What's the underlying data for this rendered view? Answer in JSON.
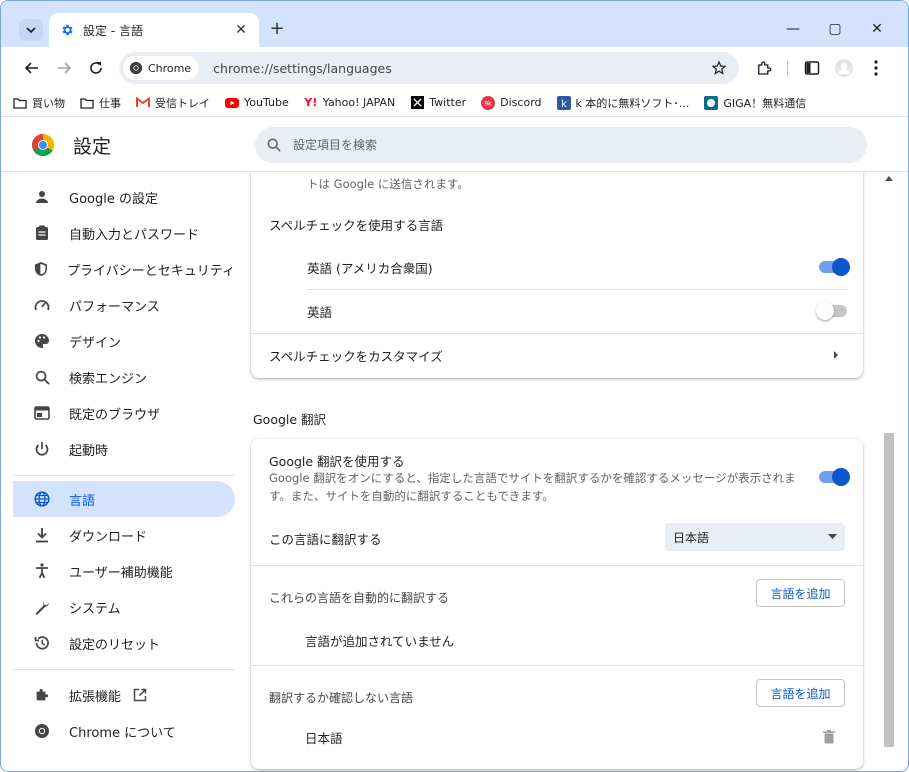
{
  "tab": {
    "title": "設定 - 言語",
    "close": "✕"
  },
  "window": {
    "minimize": "—",
    "maximize": "▢",
    "close": "✕"
  },
  "toolbar": {
    "chip_label": "Chrome",
    "url": "chrome://settings/languages"
  },
  "bookmarks": [
    {
      "label": "買い物",
      "icon": "folder-icon"
    },
    {
      "label": "仕事",
      "icon": "folder-icon"
    },
    {
      "label": "受信トレイ",
      "icon": "gmail-icon"
    },
    {
      "label": "YouTube",
      "icon": "youtube-icon"
    },
    {
      "label": "Yahoo! JAPAN",
      "icon": "yahoo-icon"
    },
    {
      "label": "Twitter",
      "icon": "x-icon"
    },
    {
      "label": "Discord",
      "icon": "discord-icon"
    },
    {
      "label": "k 本的に無料ソフト･...",
      "icon": "k-icon"
    },
    {
      "label": "GIGA！無料通信",
      "icon": "giga-icon"
    }
  ],
  "header": {
    "title": "設定",
    "search_placeholder": "設定項目を検索"
  },
  "sidebar": {
    "items": [
      {
        "label": "Google の設定",
        "icon": "person-icon"
      },
      {
        "label": "自動入力とパスワード",
        "icon": "clipboard-icon"
      },
      {
        "label": "プライバシーとセキュリティ",
        "icon": "shield-icon"
      },
      {
        "label": "パフォーマンス",
        "icon": "speedometer-icon"
      },
      {
        "label": "デザイン",
        "icon": "palette-icon"
      },
      {
        "label": "検索エンジン",
        "icon": "search-icon"
      },
      {
        "label": "既定のブラウザ",
        "icon": "browser-icon"
      },
      {
        "label": "起動時",
        "icon": "power-icon"
      },
      {
        "label": "言語",
        "icon": "globe-icon"
      },
      {
        "label": "ダウンロード",
        "icon": "download-icon"
      },
      {
        "label": "ユーザー補助機能",
        "icon": "accessibility-icon"
      },
      {
        "label": "システム",
        "icon": "wrench-icon"
      },
      {
        "label": "設定のリセット",
        "icon": "history-icon"
      },
      {
        "label": "拡張機能",
        "icon": "puzzle-icon"
      },
      {
        "label": "Chrome について",
        "icon": "chrome-icon"
      }
    ]
  },
  "main": {
    "top_card": {
      "partial_text": "トは Google に送信されます。",
      "spellcheck_title": "スペルチェックを使用する言語",
      "languages": [
        {
          "label": "英語 (アメリカ合衆国)",
          "enabled": true
        },
        {
          "label": "英語",
          "enabled": false
        }
      ],
      "customize_label": "スペルチェックをカスタマイズ"
    },
    "translate_section_title": "Google 翻訳",
    "translate_card": {
      "use_title": "Google 翻訳を使用する",
      "use_desc": "Google 翻訳をオンにすると、指定した言語でサイトを翻訳するかを確認するメッセージが表示されます。また、サイトを自動的に翻訳することもできます。",
      "use_enabled": true,
      "target_label": "この言語に翻訳する",
      "target_value": "日本語",
      "auto_label": "これらの言語を自動的に翻訳する",
      "add_language_label": "言語を追加",
      "no_languages": "言語が追加されていません",
      "never_label": "翻訳するか確認しない言語",
      "never_languages": [
        "日本語"
      ]
    }
  },
  "colors": {
    "accent": "#0b57d0",
    "active_bg": "#d3e3fd",
    "tabstrip": "#d3e3fd"
  }
}
